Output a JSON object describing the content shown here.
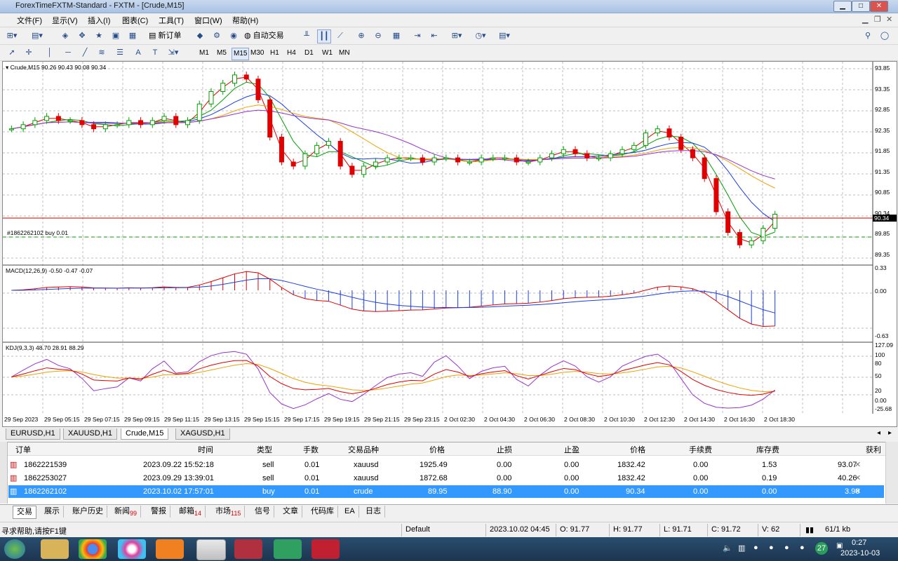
{
  "window": {
    "title": "ForexTimeFXTM-Standard - FXTM - [Crude,M15]",
    "min": "▁",
    "max": "□",
    "close": "✕"
  },
  "menu": [
    "文件(F)",
    "显示(V)",
    "插入(I)",
    "图表(C)",
    "工具(T)",
    "窗口(W)",
    "帮助(H)"
  ],
  "toolbar": {
    "new_order": "新订单",
    "auto_trade": "自动交易"
  },
  "timeframes": [
    "M1",
    "M5",
    "M15",
    "M30",
    "H1",
    "H4",
    "D1",
    "W1",
    "MN"
  ],
  "active_timeframe": "M15",
  "chart": {
    "header": "Crude,M15  90.26 90.43 90.08 90.34",
    "order_label": "#1862262102 buy 0.01",
    "price_ticks": [
      "93.85",
      "93.35",
      "92.85",
      "92.35",
      "91.85",
      "91.35",
      "90.85",
      "90.34",
      "89.85",
      "89.35"
    ],
    "current_price": "90.34",
    "macd_label": "MACD(12,26,9) -0.50 -0.47 -0.07",
    "macd_ticks": [
      "0.33",
      "0.00",
      "-0.63"
    ],
    "kdj_label": "KDJ(9,3,3) 48.70 28.91 88.29",
    "kdj_ticks": [
      "127.09",
      "100",
      "80",
      "50",
      "20",
      "0.00",
      "-25.68"
    ],
    "time_ticks": [
      "29 Sep 2023",
      "29 Sep 05:15",
      "29 Sep 07:15",
      "29 Sep 09:15",
      "29 Sep 11:15",
      "29 Sep 13:15",
      "29 Sep 15:15",
      "29 Sep 17:15",
      "29 Sep 19:15",
      "29 Sep 21:15",
      "29 Sep 23:15",
      "2 Oct 02:30",
      "2 Oct 04:30",
      "2 Oct 06:30",
      "2 Oct 08:30",
      "2 Oct 10:30",
      "2 Oct 12:30",
      "2 Oct 14:30",
      "2 Oct 16:30",
      "2 Oct 18:30"
    ],
    "colors": {
      "bull": "#00a000",
      "bear": "#e00000",
      "line_red": "#e00000",
      "line_green": "#00a000",
      "line_blue": "#1a3ee0",
      "line_orange": "#f0a000",
      "line_purple": "#9933cc"
    }
  },
  "chart_data": {
    "type": "candlestick",
    "symbol": "Crude",
    "timeframe": "M15",
    "ylim": [
      89.35,
      93.85
    ],
    "close_series": [
      92.4,
      92.5,
      92.6,
      92.7,
      92.6,
      92.6,
      92.5,
      92.4,
      92.5,
      92.5,
      92.6,
      92.5,
      92.6,
      92.7,
      92.5,
      92.6,
      93.0,
      93.3,
      93.5,
      93.7,
      93.6,
      93.1,
      92.2,
      91.6,
      91.5,
      91.8,
      92.0,
      92.1,
      91.5,
      91.3,
      91.5,
      91.6,
      91.7,
      91.7,
      91.7,
      91.6,
      91.7,
      91.7,
      91.6,
      91.6,
      91.7,
      91.7,
      91.7,
      91.6,
      91.6,
      91.7,
      91.8,
      91.9,
      91.8,
      91.7,
      91.7,
      91.8,
      91.9,
      92.0,
      92.3,
      92.4,
      92.2,
      91.9,
      91.7,
      91.2,
      90.4,
      89.9,
      89.6,
      89.7,
      90.0,
      90.34
    ]
  },
  "chart_tabs": [
    "EURUSD,H1",
    "XAUUSD,H1",
    "Crude,M15",
    "XAGUSD,H1"
  ],
  "active_chart_tab": "Crude,M15",
  "terminal": {
    "headers": [
      "订单",
      "时间",
      "类型",
      "手数",
      "交易品种",
      "价格",
      "止损",
      "止盈",
      "价格",
      "手续费",
      "库存费",
      "获利"
    ],
    "rows": [
      {
        "order": "1862221539",
        "time": "2023.09.22 15:52:18",
        "type": "sell",
        "lots": "0.01",
        "symbol": "xauusd",
        "price": "1925.49",
        "sl": "0.00",
        "tp": "0.00",
        "cur": "1832.42",
        "comm": "0.00",
        "swap": "1.53",
        "profit": "93.07"
      },
      {
        "order": "1862253027",
        "time": "2023.09.29 13:39:01",
        "type": "sell",
        "lots": "0.01",
        "symbol": "xauusd",
        "price": "1872.68",
        "sl": "0.00",
        "tp": "0.00",
        "cur": "1832.42",
        "comm": "0.00",
        "swap": "0.19",
        "profit": "40.26"
      },
      {
        "order": "1862262102",
        "time": "2023.10.02 17:57:01",
        "type": "buy",
        "lots": "0.01",
        "symbol": "crude",
        "price": "89.95",
        "sl": "88.90",
        "tp": "0.00",
        "cur": "90.34",
        "comm": "0.00",
        "swap": "0.00",
        "profit": "3.90"
      }
    ]
  },
  "bottom_tabs": [
    {
      "label": "交易",
      "badge": ""
    },
    {
      "label": "展示",
      "badge": ""
    },
    {
      "label": "账户历史",
      "badge": ""
    },
    {
      "label": "新闻",
      "badge": "99"
    },
    {
      "label": "警报",
      "badge": ""
    },
    {
      "label": "邮箱",
      "badge": "14"
    },
    {
      "label": "市场",
      "badge": "115"
    },
    {
      "label": "信号",
      "badge": ""
    },
    {
      "label": "文章",
      "badge": ""
    },
    {
      "label": "代码库",
      "badge": ""
    },
    {
      "label": "EA",
      "badge": ""
    },
    {
      "label": "日志",
      "badge": ""
    }
  ],
  "status": {
    "help": "寻求帮助,请按F1键",
    "profile": "Default",
    "datetime": "2023.10.02 04:45",
    "open": "O: 91.77",
    "high": "H: 91.77",
    "low": "L: 91.71",
    "close": "C: 91.72",
    "volume": "V: 62",
    "traffic": "61/1 kb"
  },
  "taskbar": {
    "time": "0:27",
    "date": "2023-10-03",
    "badge": "27"
  }
}
